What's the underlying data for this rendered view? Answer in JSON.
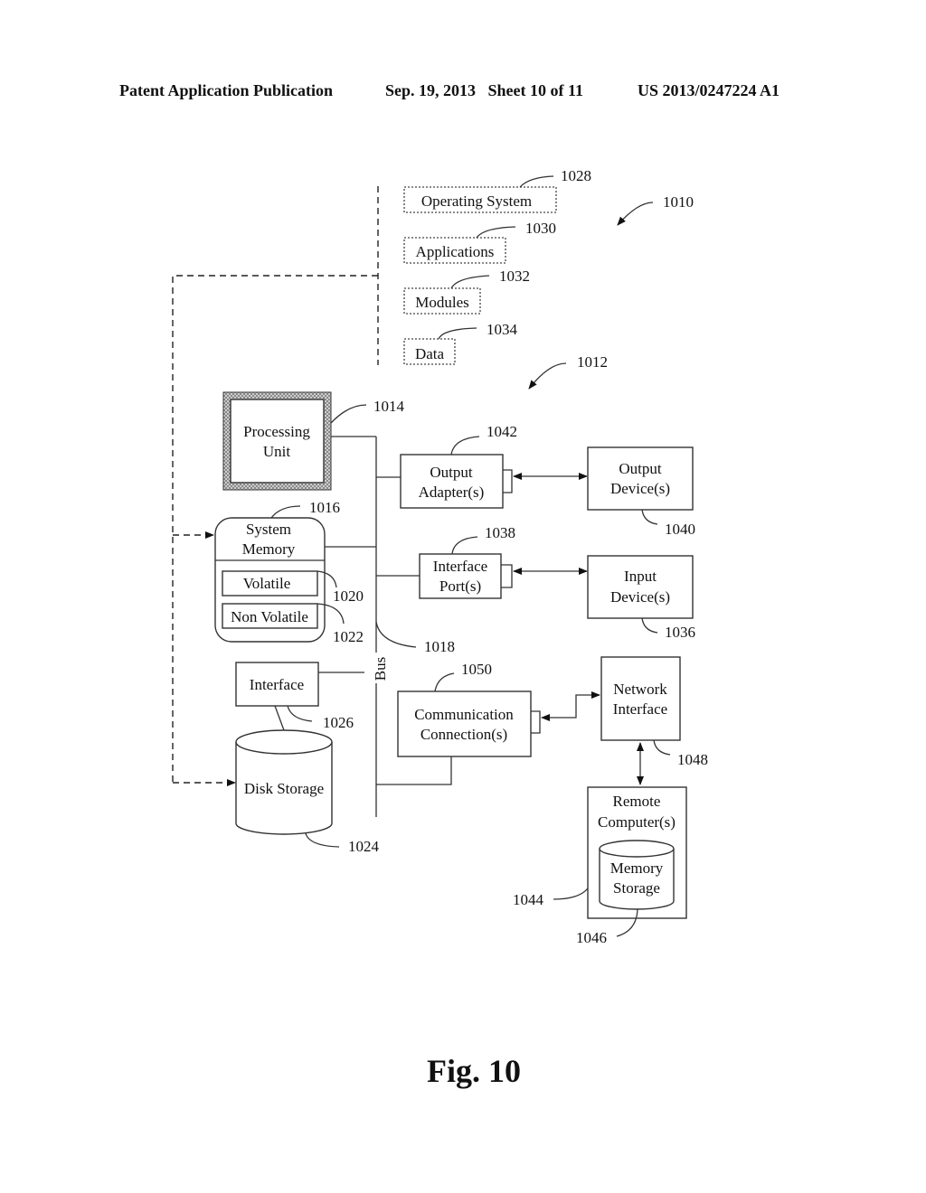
{
  "header": {
    "publication": "Patent Application Publication",
    "date_sheet": "Sep. 19, 2013   Sheet 10 of 11",
    "patent_number": "US 2013/0247224 A1"
  },
  "diagram": {
    "software": {
      "os": {
        "label": "Operating System",
        "ref": "1028"
      },
      "applications": {
        "label": "Applications",
        "ref": "1030"
      },
      "modules": {
        "label": "Modules",
        "ref": "1032"
      },
      "data": {
        "label": "Data",
        "ref": "1034"
      }
    },
    "environment_ref": "1010",
    "computer_ref": "1012",
    "processing_unit": {
      "line1": "Processing",
      "line2": "Unit",
      "ref": "1014"
    },
    "system_memory": {
      "line1": "System",
      "line2": "Memory",
      "ref": "1016",
      "volatile": {
        "label": "Volatile",
        "ref": "1020"
      },
      "non_volatile": {
        "label": "Non Volatile",
        "ref": "1022"
      }
    },
    "bus": {
      "label": "Bus",
      "ref": "1018"
    },
    "interface": {
      "label": "Interface",
      "ref": "1026"
    },
    "disk_storage": {
      "label": "Disk Storage",
      "ref": "1024"
    },
    "output_adapter": {
      "line1": "Output",
      "line2": "Adapter(s)",
      "ref": "1042"
    },
    "output_device": {
      "line1": "Output",
      "line2": "Device(s)",
      "ref": "1040"
    },
    "interface_port": {
      "line1": "Interface",
      "line2": "Port(s)",
      "ref": "1038"
    },
    "input_device": {
      "line1": "Input",
      "line2": "Device(s)",
      "ref": "1036"
    },
    "communication": {
      "line1": "Communication",
      "line2": "Connection(s)",
      "ref": "1050"
    },
    "network_interface": {
      "line1": "Network",
      "line2": "Interface",
      "ref": "1048"
    },
    "remote_computer": {
      "line1": "Remote",
      "line2": "Computer(s)",
      "ref": "1044",
      "memory_storage": {
        "line1": "Memory",
        "line2": "Storage",
        "ref": "1046"
      }
    }
  },
  "caption": "Fig. 10"
}
